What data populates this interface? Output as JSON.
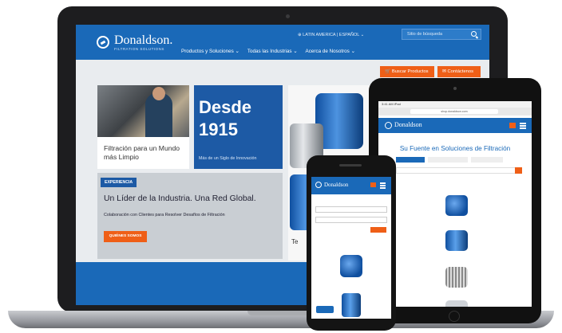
{
  "brand": {
    "name": "Donaldson.",
    "tagline": "FILTRATION SOLUTIONS"
  },
  "header": {
    "region": "⊕ LATIN AMERICA | ESPAÑOL ⌄",
    "search_placeholder": "Sitio de búsqueda",
    "nav": [
      "Productos y Soluciones ⌄",
      "Todas las Industrias ⌄",
      "Acerca de Nosotros ⌄"
    ]
  },
  "actions": {
    "buscar": "🛒 Buscar Productos",
    "contact": "✉ Contáctenos"
  },
  "tiles": {
    "photo_caption": "Filtración para un Mundo más Limpio",
    "since_heading": "Desde 1915",
    "since_sub": "Más de un Siglo de Innovación",
    "experience_badge": "EXPERIENCIA",
    "experience_heading": "Un Líder de la Industria. Una Red Global.",
    "experience_text": "Colaboración con Clientes para Resolver Desafíos de Filtración",
    "experience_button": "QUIÉNES SOMOS",
    "filters_label": "Te"
  },
  "tablet": {
    "status": "3:41 AM iPad",
    "url": "shop.donaldson.com",
    "logo": "Donaldson",
    "title": "Su Fuente en Soluciones de Filtración"
  },
  "phone": {
    "logo": "Donaldson"
  },
  "colors": {
    "primary": "#1a69b8",
    "accent": "#ef5f17",
    "dark_blue": "#1d5aa5"
  }
}
